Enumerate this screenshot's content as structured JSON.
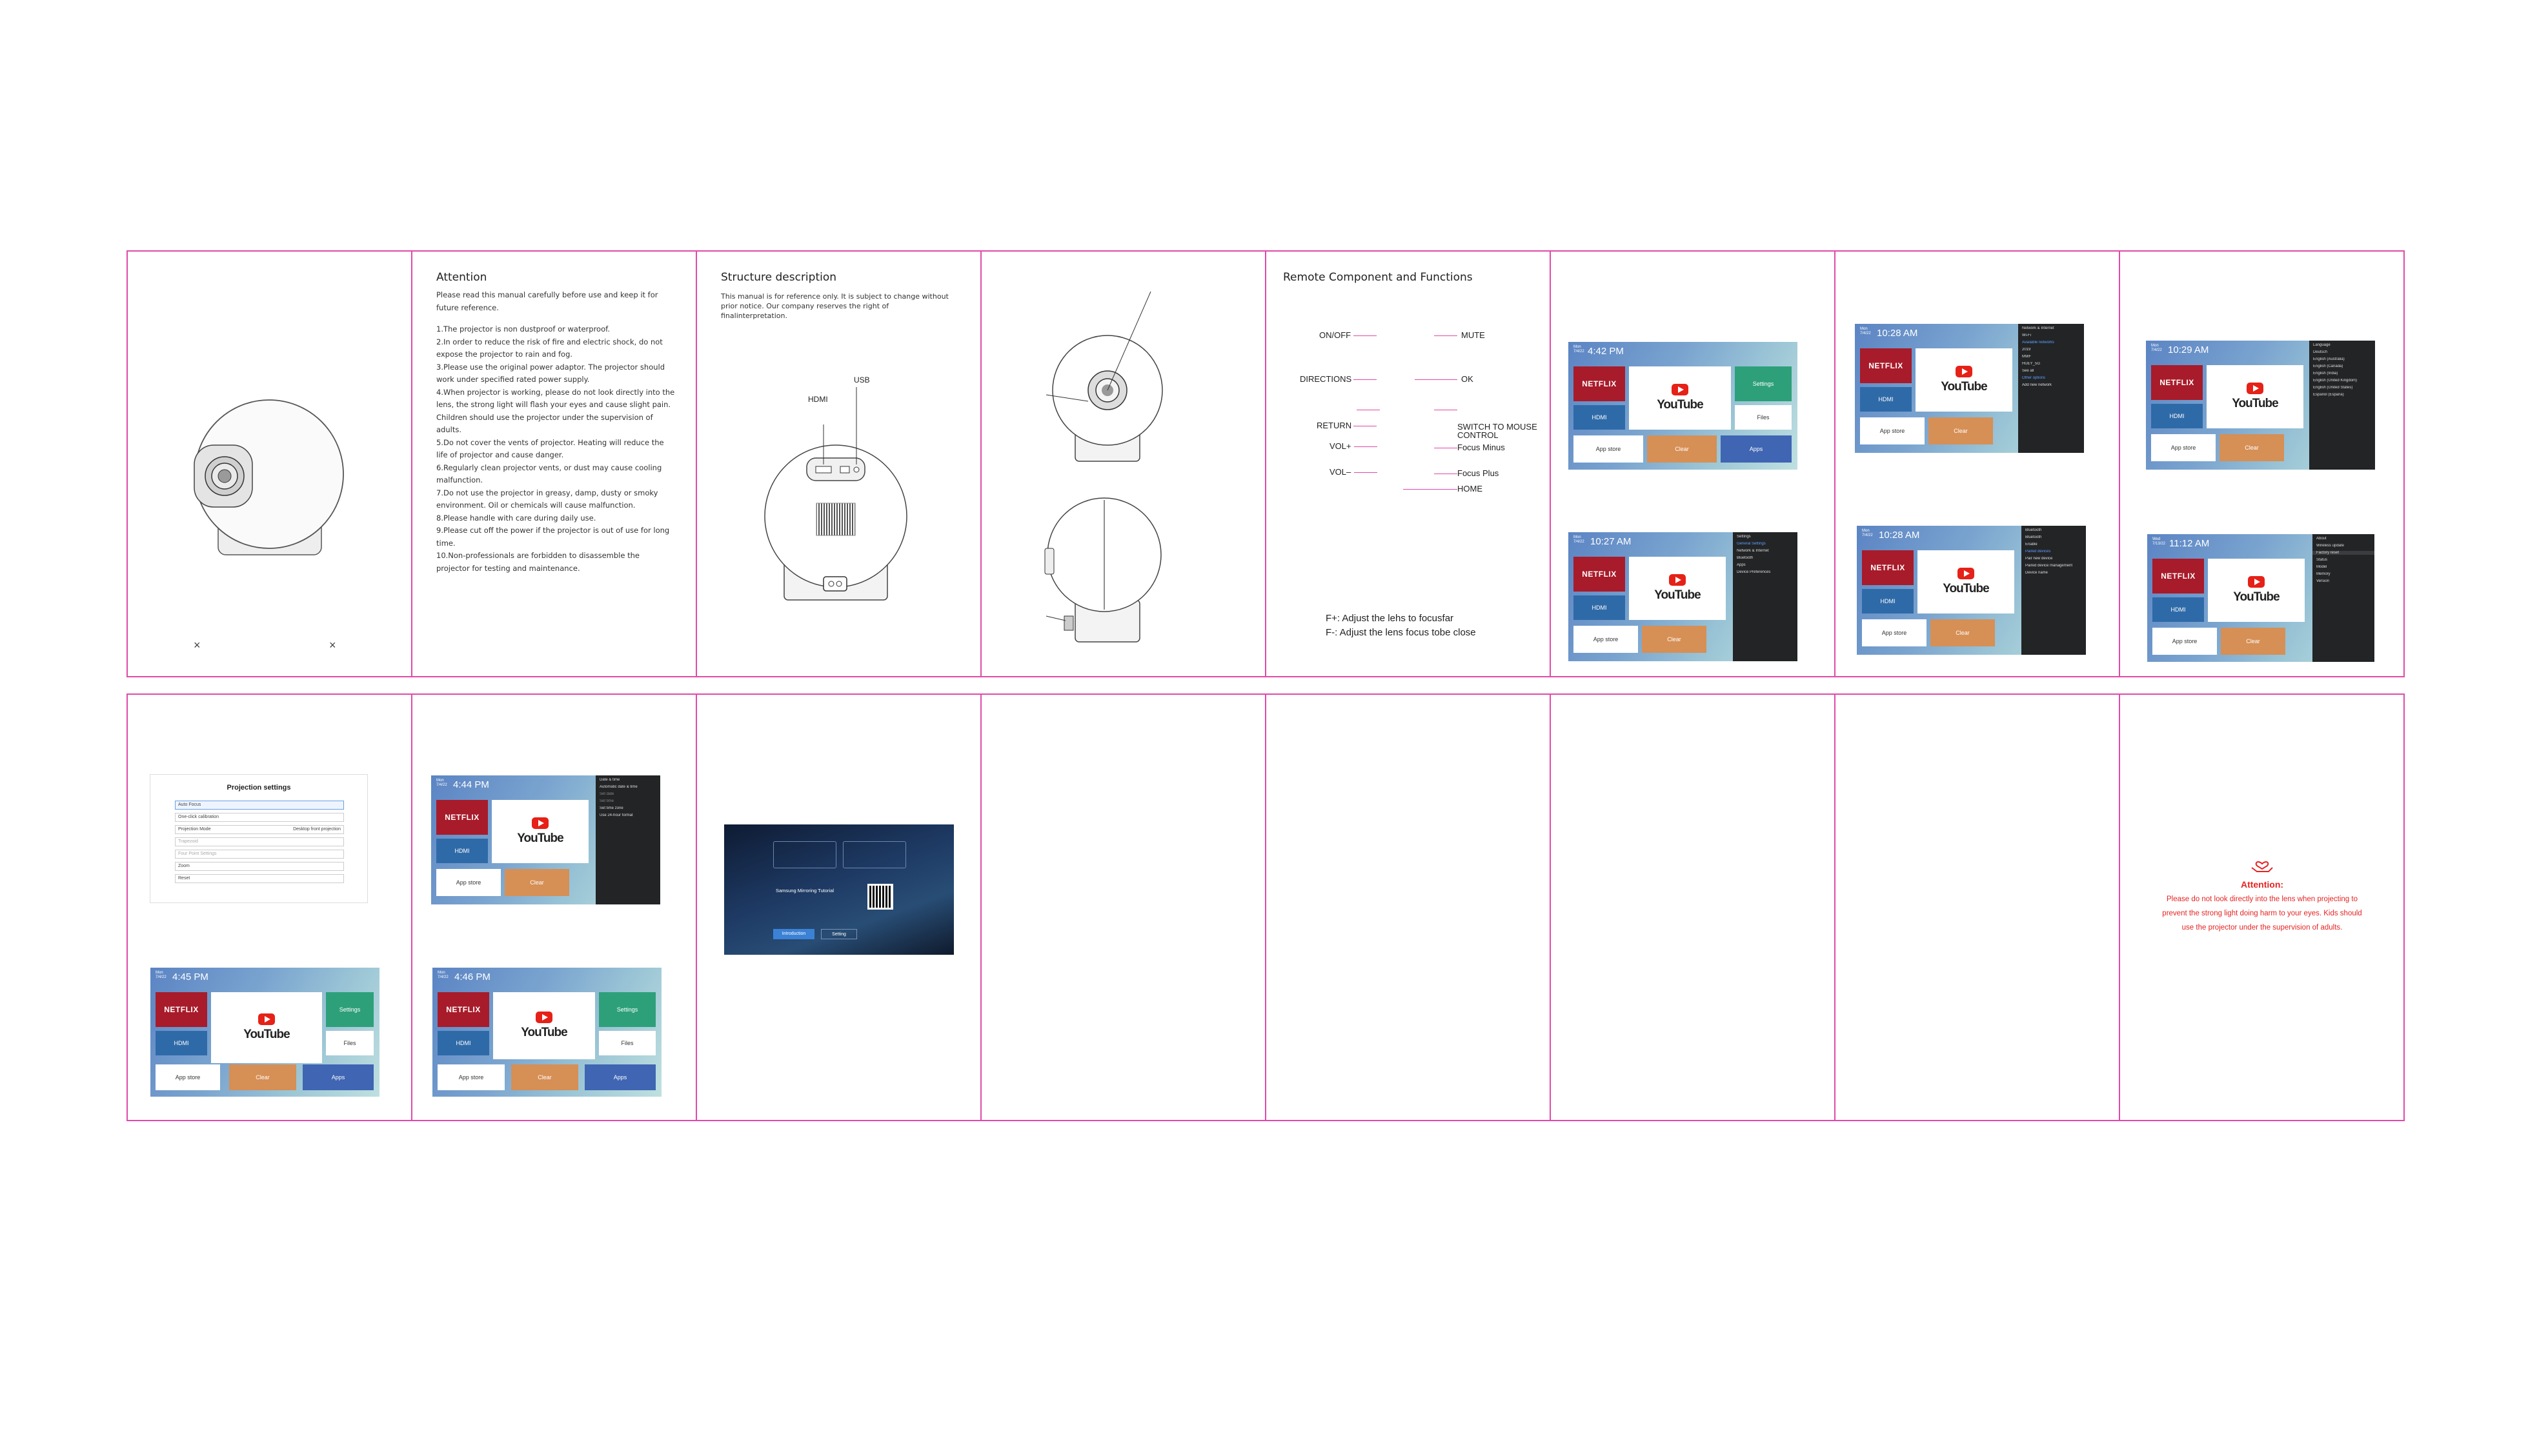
{
  "attention": {
    "title": "Attention",
    "intro": "Please read this manual carefully before use and keep it for future reference.",
    "items": [
      "1.The projector is non dustproof or waterproof.",
      "2.In order to reduce the risk of fire and electric shock, do not expose the projector to rain and fog.",
      "3.Please use the original power adaptor. The projector should work under specified rated power supply.",
      "4.When projector is working, please do not look directly into the lens, the strong light will flash your eyes and cause slight pain. Children should use the projector under the supervision of adults.",
      "5.Do not cover the vents of projector. Heating will reduce the life of projector and cause danger.",
      "6.Regularly clean projector vents, or dust may cause cooling malfunction.",
      "7.Do not use the projector in greasy, damp, dusty or smoky environment. Oil or chemicals will cause malfunction.",
      "8.Please handle with care during daily use.",
      "9.Please cut off the power if the projector is out of use for long time.",
      "10.Non-professionals are forbidden to disassemble the projector for testing and maintenance."
    ]
  },
  "cover": {
    "marks": [
      "×",
      "×"
    ]
  },
  "structure": {
    "title": "Structure description",
    "intro": "This manual is for reference only. It is subject to change without prior notice. Our company reserves the right of finalinterpretation.",
    "labels": {
      "hdmi": "HDMI",
      "usb": "USB"
    }
  },
  "remote": {
    "title": "Remote Component and Functions",
    "left": [
      "ON/OFF",
      "DIRECTIONS",
      "RETURN",
      "VOL+",
      "VOL–"
    ],
    "right": [
      "MUTE",
      "OK",
      "SWITCH TO MOUSE",
      "CONTROL",
      "Focus Minus",
      "Focus Plus",
      "HOME"
    ],
    "notes": [
      "F+: Adjust the lehs to focusfar",
      "F-: Adjust the lens focus tobe close"
    ]
  },
  "screens": {
    "tiles": {
      "netflix": "NETFLIX",
      "hdmi": "HDMI",
      "youtube": "YouTube",
      "settings": "Settings",
      "files": "Files",
      "appstore": "App store",
      "clear": "Clear",
      "apps": "Apps"
    },
    "date": "Mon\n7/4/22",
    "times": [
      "4:42 PM",
      "10:28 AM",
      "10:29 AM",
      "10:27 AM",
      "10:28 AM",
      "11:12 AM",
      "4:44 PM",
      "4:45 PM",
      "4:46 PM"
    ],
    "network_panel": [
      "Network & Internet",
      "Wi-Fi",
      "Available networks",
      "2019",
      "MWF",
      "HUEY_5G",
      "See all",
      "Other options",
      "Add new network"
    ],
    "language_panel": [
      "Language",
      "Deutsch",
      "English (Australia)",
      "English (Canada)",
      "English (India)",
      "English (United Kingdom)",
      "English (United States)",
      "Español (España)"
    ],
    "settings_panel": [
      "Settings",
      "General Settings",
      "Network & Internet",
      "Bluetooth",
      "Apps",
      "Device Preferences"
    ],
    "bluetooth_panel": [
      "Bluetooth",
      "Bluetooth",
      "Enable",
      "Paired devices",
      "Pair new device",
      "Paired device management",
      "Device name"
    ],
    "about_panel": [
      "About",
      "Wireless update",
      "Factory reset",
      "Status",
      "Model",
      "Memory",
      "Version"
    ],
    "date_panel": [
      "Date & time",
      "Automatic date & time",
      "Set date",
      "Set time",
      "Set time zone",
      "Use 24-hour format"
    ]
  },
  "projection": {
    "title": "Projection settings",
    "rows": [
      "Auto Focus",
      "One-click calibration",
      "Projection Mode",
      "Trapezoid",
      "Four Point Settings",
      "Zoom",
      "Reset"
    ],
    "mode_value": "Desktop front projection"
  },
  "mirror": {
    "heading": "Samsung Mirroring Tutorial",
    "buttons": [
      "Introduction",
      "Setting"
    ]
  },
  "warning": {
    "title": "Attention:",
    "text": "Please do not look directly into the lens when projecting to prevent the strong light doing harm to your eyes. Kids should use the projector under the supervision of adults."
  }
}
